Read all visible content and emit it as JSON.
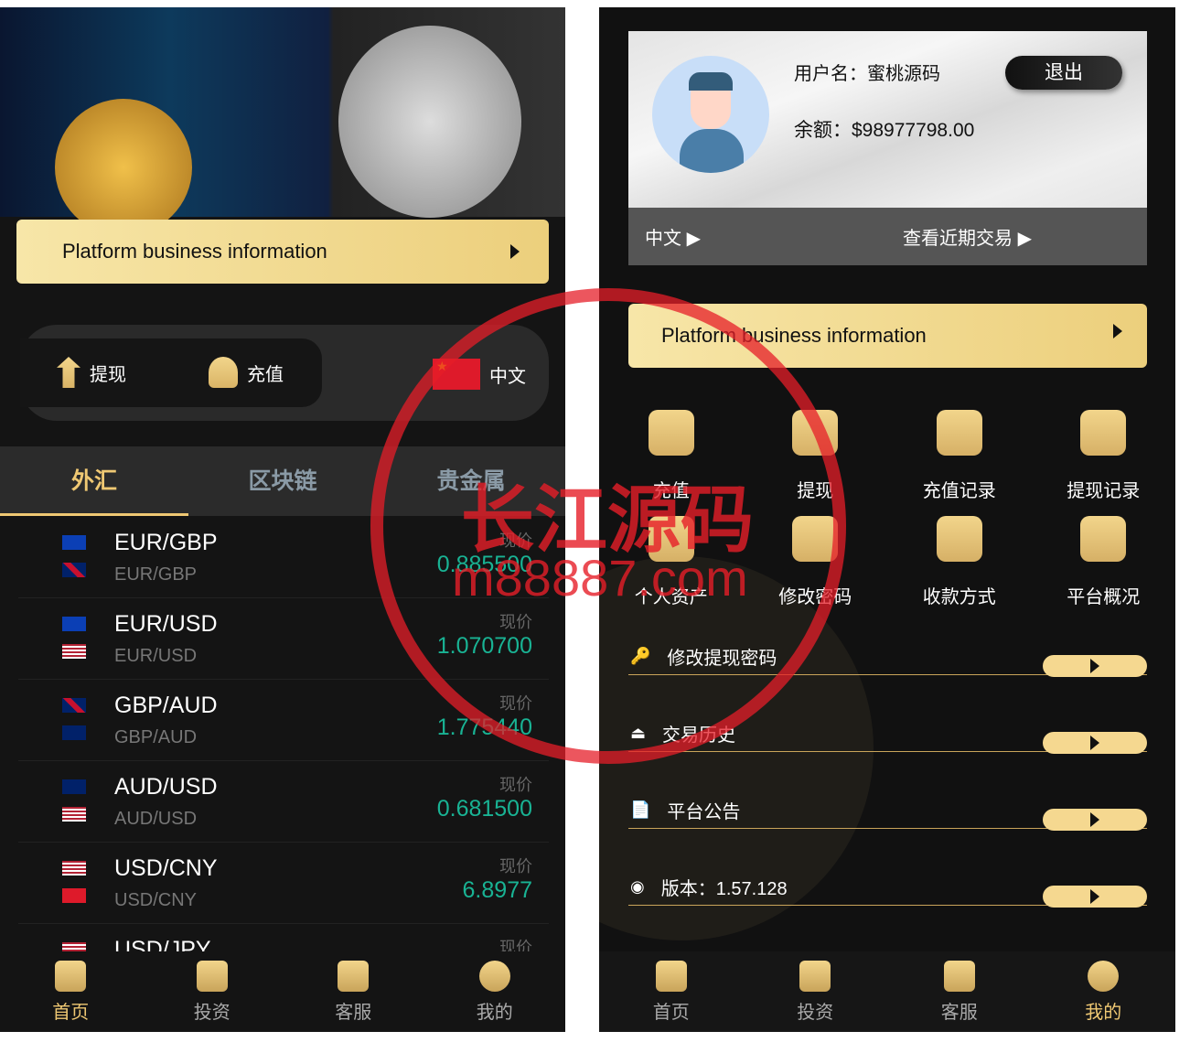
{
  "left": {
    "banner_label": "Platform business information",
    "actions": [
      {
        "label": "提现",
        "icon": "withdraw-icon"
      },
      {
        "label": "充值",
        "icon": "deposit-icon"
      }
    ],
    "language": "中文",
    "tabs": [
      "外汇",
      "区块链",
      "贵金属"
    ],
    "price_label": "现价",
    "rows": [
      {
        "pair": "EUR/GBP",
        "sub": "EUR/GBP",
        "price": "0.885500"
      },
      {
        "pair": "EUR/USD",
        "sub": "EUR/USD",
        "price": "1.070700"
      },
      {
        "pair": "GBP/AUD",
        "sub": "GBP/AUD",
        "price": "1.775440"
      },
      {
        "pair": "AUD/USD",
        "sub": "AUD/USD",
        "price": "0.681500"
      },
      {
        "pair": "USD/CNY",
        "sub": "USD/CNY",
        "price": "6.8977"
      },
      {
        "pair": "USD/JPY",
        "sub": "",
        "price": ""
      }
    ]
  },
  "nav": [
    {
      "label": "首页"
    },
    {
      "label": "投资"
    },
    {
      "label": "客服"
    },
    {
      "label": "我的"
    }
  ],
  "right": {
    "username": "用户名：蜜桃源码",
    "balance": "余额：$98977798.00",
    "logout": "退出",
    "language": "中文",
    "recent": "查看近期交易",
    "banner_label": "Platform business information",
    "grid1": [
      "充值",
      "提现",
      "充值记录",
      "提现记录"
    ],
    "grid2": [
      "个人资产",
      "修改密码",
      "收款方式",
      "平台概况"
    ],
    "list": [
      "修改提现密码",
      "交易历史",
      "平台公告",
      "版本：1.57.128"
    ]
  },
  "colors": {
    "gold": "#efc873",
    "green": "#19b394",
    "bg": "#141414"
  },
  "watermark": "长江源码 m88887.com"
}
